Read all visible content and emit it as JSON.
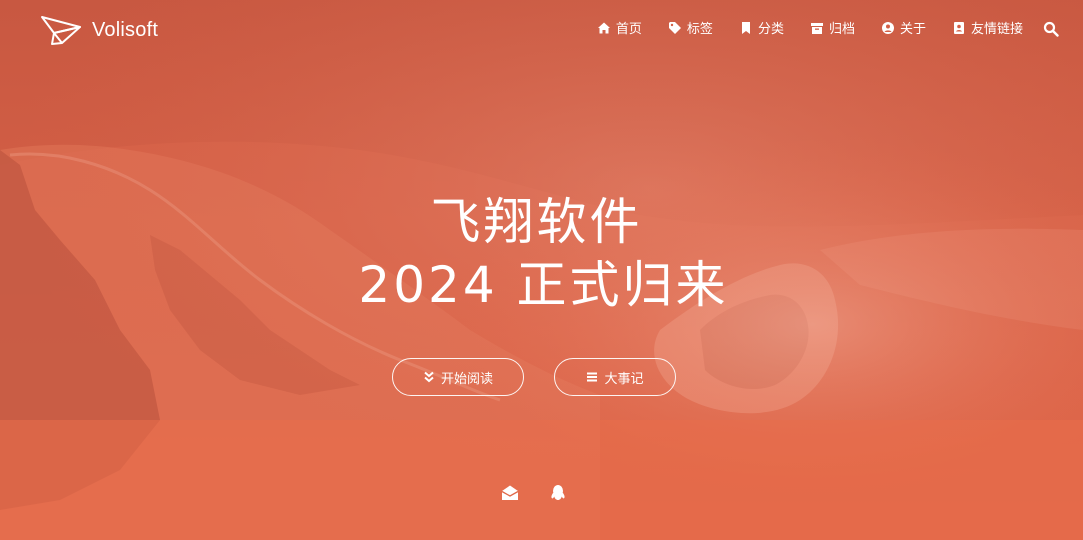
{
  "brand": {
    "name": "Volisoft",
    "logo_icon": "paper-plane-icon"
  },
  "nav": {
    "items": [
      {
        "label": "首页",
        "icon": "home-icon"
      },
      {
        "label": "标签",
        "icon": "tags-icon"
      },
      {
        "label": "分类",
        "icon": "bookmark-icon"
      },
      {
        "label": "归档",
        "icon": "archive-icon"
      },
      {
        "label": "关于",
        "icon": "user-circle-icon"
      },
      {
        "label": "友情链接",
        "icon": "address-book-icon"
      }
    ],
    "search_icon": "search-icon"
  },
  "hero": {
    "title_line1": "飞翔软件",
    "title_line2": "2024  正式归来",
    "background_color": "#d9654a",
    "buttons": [
      {
        "label": "开始阅读",
        "icon": "chevron-double-down-icon"
      },
      {
        "label": "大事记",
        "icon": "list-icon"
      }
    ]
  },
  "social": [
    {
      "icon": "envelope-open-icon"
    },
    {
      "icon": "qq-icon"
    }
  ]
}
